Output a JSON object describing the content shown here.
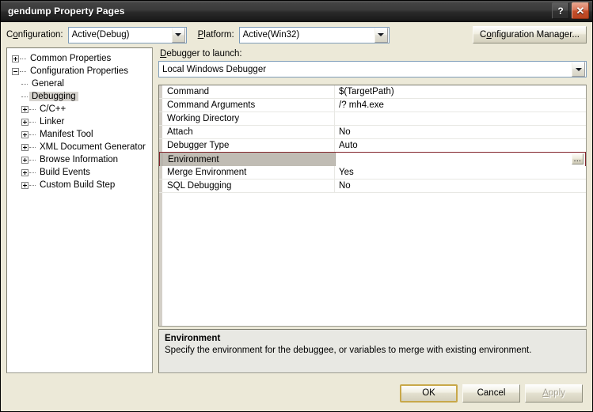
{
  "window": {
    "title": "gendump Property Pages",
    "help_button": "?",
    "close_button": "✕",
    "help_icon_name": "help-icon",
    "close_icon_name": "close-icon"
  },
  "config_bar": {
    "configuration_label_pre": "C",
    "configuration_label_accel": "o",
    "configuration_label_post": "nfiguration:",
    "configuration_value": "Active(Debug)",
    "platform_label_accel": "P",
    "platform_label_post": "latform:",
    "platform_value": "Active(Win32)",
    "config_manager_pre": "C",
    "config_manager_accel": "o",
    "config_manager_post": "nfiguration Manager..."
  },
  "tree": {
    "nodes": [
      {
        "label": "Common Properties",
        "state": "collapsed",
        "level": 0,
        "selected": false
      },
      {
        "label": "Configuration Properties",
        "state": "expanded",
        "level": 0,
        "selected": false
      },
      {
        "label": "General",
        "state": "leaf",
        "level": 1,
        "selected": false
      },
      {
        "label": "Debugging",
        "state": "leaf",
        "level": 1,
        "selected": true
      },
      {
        "label": "C/C++",
        "state": "collapsed",
        "level": 1,
        "selected": false
      },
      {
        "label": "Linker",
        "state": "collapsed",
        "level": 1,
        "selected": false
      },
      {
        "label": "Manifest Tool",
        "state": "collapsed",
        "level": 1,
        "selected": false
      },
      {
        "label": "XML Document Generator",
        "state": "collapsed",
        "level": 1,
        "selected": false
      },
      {
        "label": "Browse Information",
        "state": "collapsed",
        "level": 1,
        "selected": false
      },
      {
        "label": "Build Events",
        "state": "collapsed",
        "level": 1,
        "selected": false
      },
      {
        "label": "Custom Build Step",
        "state": "collapsed",
        "level": 1,
        "selected": false
      }
    ]
  },
  "debugger": {
    "label_accel": "D",
    "label_post": "ebugger to launch:",
    "value": "Local Windows Debugger"
  },
  "property_grid": {
    "rows": [
      {
        "name": "Command",
        "value": "$(TargetPath)",
        "selected": false,
        "has_ellipsis": false
      },
      {
        "name": "Command Arguments",
        "value": "/? mh4.exe",
        "selected": false,
        "has_ellipsis": false
      },
      {
        "name": "Working Directory",
        "value": "",
        "selected": false,
        "has_ellipsis": false
      },
      {
        "name": "Attach",
        "value": "No",
        "selected": false,
        "has_ellipsis": false
      },
      {
        "name": "Debugger Type",
        "value": "Auto",
        "selected": false,
        "has_ellipsis": false
      },
      {
        "name": "Environment",
        "value": "",
        "selected": true,
        "has_ellipsis": true,
        "ellipsis_label": "..."
      },
      {
        "name": "Merge Environment",
        "value": "Yes",
        "selected": false,
        "has_ellipsis": false
      },
      {
        "name": "SQL Debugging",
        "value": "No",
        "selected": false,
        "has_ellipsis": false
      }
    ]
  },
  "description": {
    "title": "Environment",
    "body": "Specify the environment for the debuggee, or variables to merge with existing environment."
  },
  "footer": {
    "ok_label": "OK",
    "cancel_label": "Cancel",
    "apply_pre": "",
    "apply_accel": "A",
    "apply_post": "pply",
    "apply_disabled": true
  },
  "colors": {
    "dialog_background": "#ece9d8",
    "titlebar_dark": "#2a2a2a",
    "close_button_red": "#c4502c",
    "selection_border": "#83252c",
    "selection_label_fill": "#c0bcb4",
    "tree_selection_fill": "#d6d3ce",
    "combo_border": "#7f9db9",
    "default_button_outline": "#c8a84a",
    "description_pane": "#e8e8e3"
  }
}
